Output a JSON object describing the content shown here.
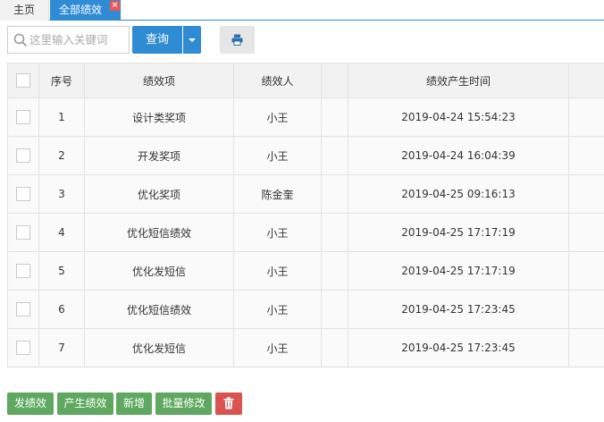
{
  "tabs": {
    "home": "主页",
    "active": "全部绩效",
    "close_glyph": "×"
  },
  "toolbar": {
    "search_placeholder": "这里输入关键词",
    "query_label": "查询"
  },
  "table": {
    "columns": [
      "序号",
      "绩效项",
      "绩效人",
      "",
      "绩效产生时间",
      ""
    ],
    "rows": [
      {
        "no": "1",
        "item": "设计类奖项",
        "person": "小王",
        "time": "2019-04-24 15:54:23"
      },
      {
        "no": "2",
        "item": "开发奖项",
        "person": "小王",
        "time": "2019-04-24 16:04:39"
      },
      {
        "no": "3",
        "item": "优化奖项",
        "person": "陈金奎",
        "time": "2019-04-25 09:16:13"
      },
      {
        "no": "4",
        "item": "优化短信绩效",
        "person": "小王",
        "time": "2019-04-25 17:17:19"
      },
      {
        "no": "5",
        "item": "优化发短信",
        "person": "小王",
        "time": "2019-04-25 17:17:19"
      },
      {
        "no": "6",
        "item": "优化短信绩效",
        "person": "小王",
        "time": "2019-04-25 17:23:45"
      },
      {
        "no": "7",
        "item": "优化发短信",
        "person": "小王",
        "time": "2019-04-25 17:23:45"
      }
    ]
  },
  "actions": {
    "issue": "发绩效",
    "generate": "产生绩效",
    "add": "新增",
    "batch_edit": "批量修改"
  },
  "colors": {
    "primary": "#2e8bd4",
    "success": "#5fa85f",
    "danger": "#d9534f"
  },
  "icons": {
    "search": "search-icon",
    "print": "print-icon",
    "delete": "trash-icon",
    "dropdown": "caret-down-icon"
  }
}
